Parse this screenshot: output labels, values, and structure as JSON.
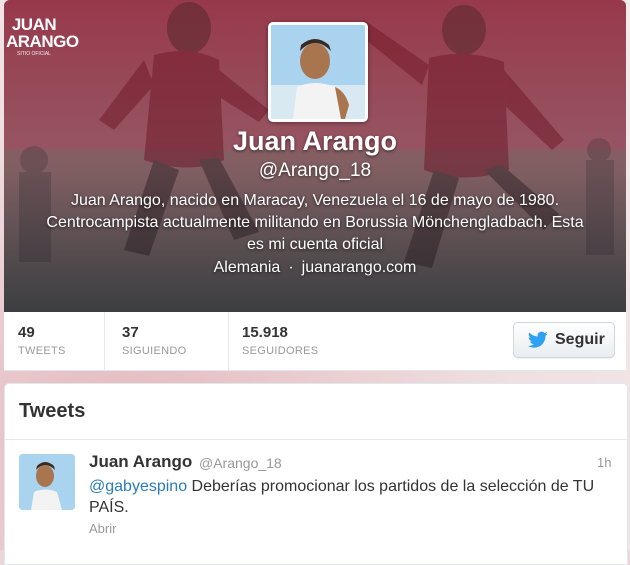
{
  "logo": {
    "line1": "JUAN",
    "line2": "ARANGO",
    "line3": "SITIO OFICIAL"
  },
  "profile": {
    "name": "Juan Arango",
    "handle": "@Arango_18",
    "bio": "Juan Arango, nacido en Maracay, Venezuela el 16 de mayo de 1980. Centrocampista actualmente militando en Borussia Mönchengladbach. Esta es mi cuenta oficial",
    "location": "Alemania",
    "separator": "·",
    "website": "juanarango.com"
  },
  "stats": [
    {
      "value": "49",
      "label": "TWEETS"
    },
    {
      "value": "37",
      "label": "SIGUIENDO"
    },
    {
      "value": "15.918",
      "label": "SEGUIDORES"
    }
  ],
  "follow_button": {
    "label": "Seguir",
    "icon": "twitter-bird-icon",
    "icon_color": "#2ea1f2"
  },
  "tweets_section": {
    "title": "Tweets",
    "items": [
      {
        "author": "Juan Arango",
        "handle": "@Arango_18",
        "time": "1h",
        "mention": "@gabyespino",
        "text": " Deberías promocionar los partidos de la selección de TU PAÍS.",
        "open_label": "Abrir"
      }
    ]
  },
  "colors": {
    "header_tint": "#8e4556",
    "link": "#2b7bb9",
    "muted": "#999999",
    "text": "#333333"
  }
}
